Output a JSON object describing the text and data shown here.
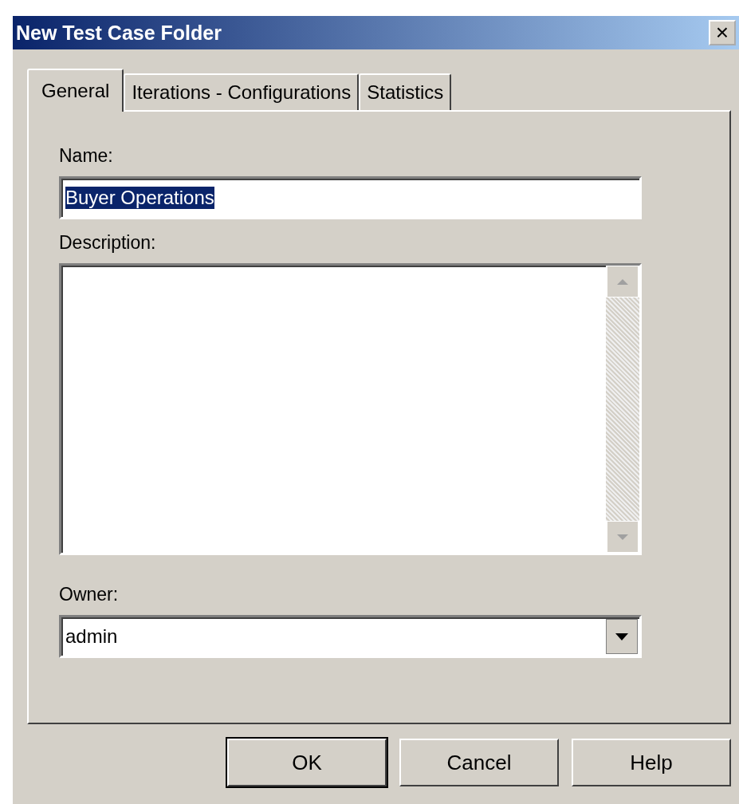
{
  "window": {
    "title": "New Test Case Folder",
    "close": "×"
  },
  "tabs": [
    {
      "label": "General",
      "selected": true
    },
    {
      "label": "Iterations - Configurations",
      "selected": false
    },
    {
      "label": "Statistics",
      "selected": false
    }
  ],
  "name": {
    "label": "Name:",
    "value": "Buyer Operations",
    "selected": true
  },
  "description": {
    "label": "Description:"
  },
  "owner": {
    "label": "Owner:",
    "value": "admin"
  },
  "buttons": [
    {
      "label": "OK",
      "default": true
    },
    {
      "label": "Cancel",
      "default": false
    },
    {
      "label": "Help",
      "default": false
    }
  ]
}
